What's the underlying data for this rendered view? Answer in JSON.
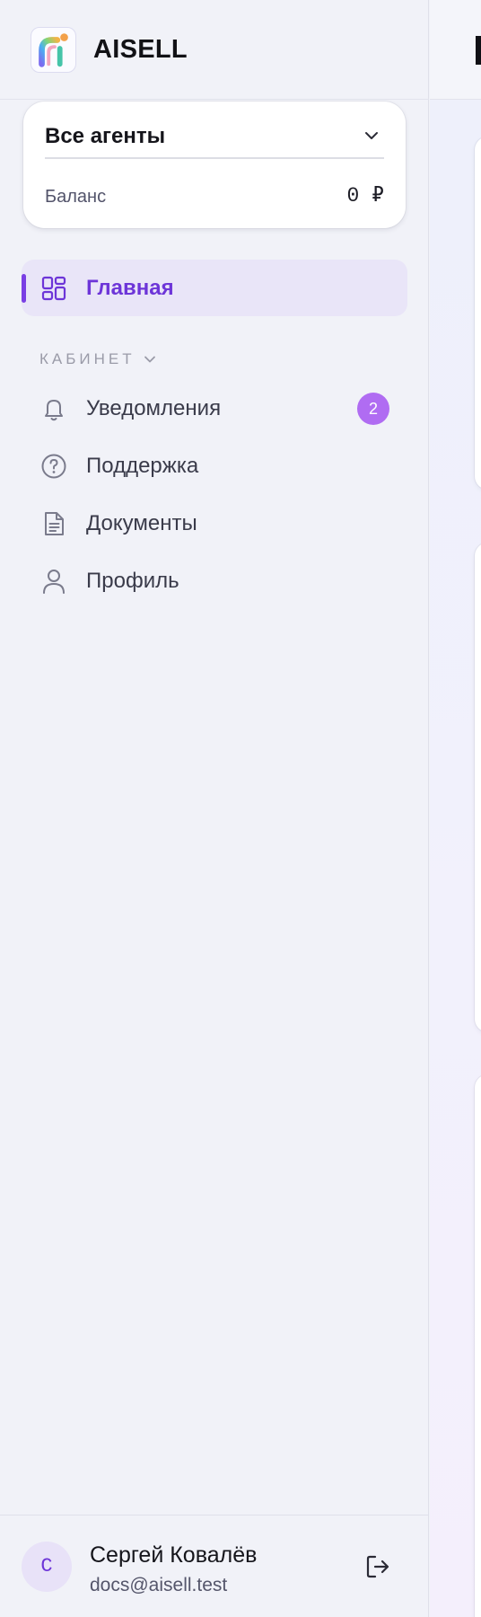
{
  "brand": {
    "name": "AISELL",
    "logo_icon": "aisell-logo-icon"
  },
  "agent_selector": {
    "selected": "Все агенты",
    "chevron_icon": "chevron-down-icon"
  },
  "balance": {
    "label": "Баланс",
    "value": "0 ₽"
  },
  "nav": {
    "active_item": {
      "label": "Главная",
      "icon": "dashboard-grid-icon"
    },
    "section": {
      "label": "КАБИНЕТ",
      "chevron_icon": "chevron-down-icon"
    },
    "items": [
      {
        "label": "Уведомления",
        "icon": "bell-icon",
        "badge": "2"
      },
      {
        "label": "Поддержка",
        "icon": "help-circle-icon"
      },
      {
        "label": "Документы",
        "icon": "document-icon"
      },
      {
        "label": "Профиль",
        "icon": "user-icon"
      }
    ]
  },
  "user": {
    "initial": "С",
    "name": "Сергей Ковалёв",
    "email": "docs@aisell.test",
    "logout_icon": "logout-icon"
  },
  "colors": {
    "accent": "#6d35d8",
    "accent_bar": "#7a3fe4",
    "active_bg": "#e9e5f8",
    "badge": "#b06cf2",
    "sidebar_bg": "#f1f2f8"
  }
}
